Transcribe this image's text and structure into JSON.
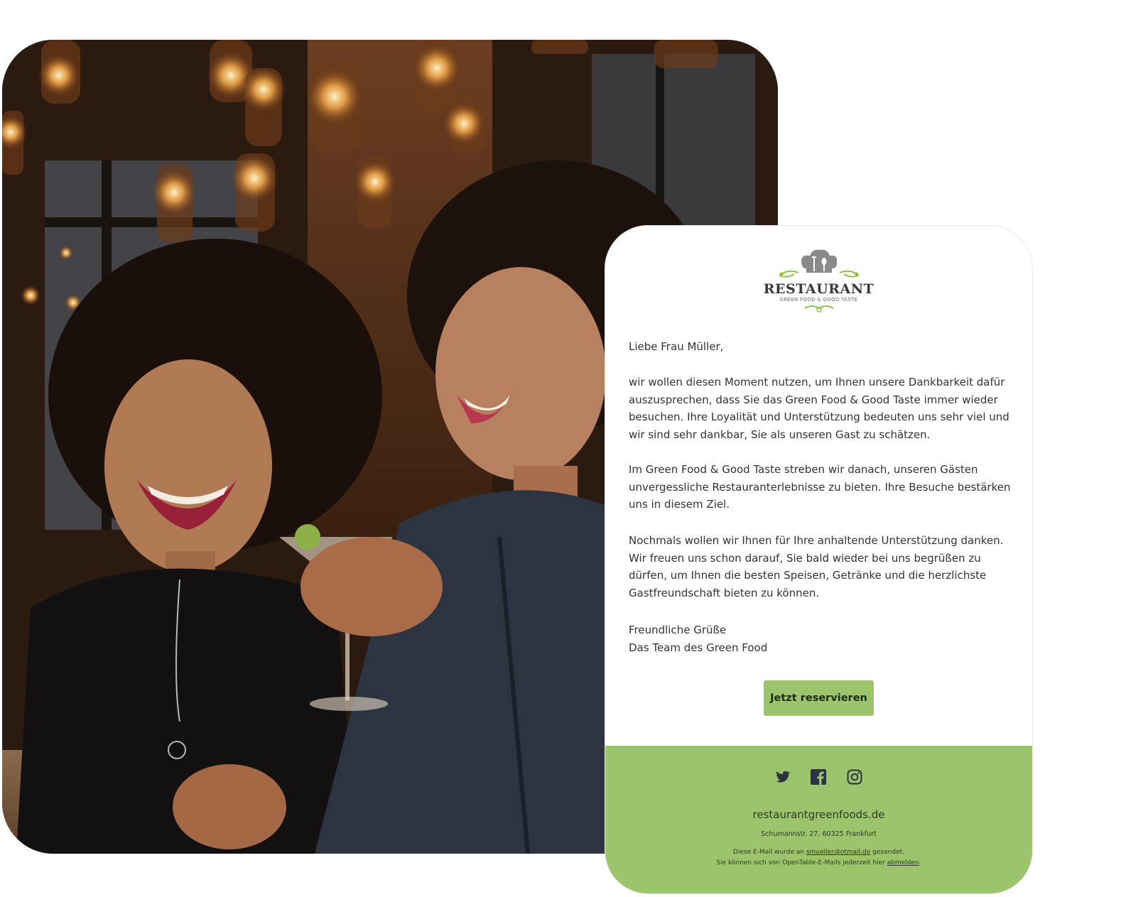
{
  "photo": {
    "description_icon": "photo-people-laughing"
  },
  "email": {
    "logo": {
      "title": "RESTAURANT",
      "subtitle": "GREEN FOOD & GOOD TASTE"
    },
    "salutation": "Liebe Frau Müller,",
    "paragraphs": [
      "wir wollen diesen Moment nutzen, um Ihnen unsere Dankbarkeit dafür auszusprechen, dass Sie das Green Food & Good Taste immer wieder besuchen. Ihre Loyalität und Unterstützung bedeuten uns sehr viel und wir sind sehr dankbar, Sie als unseren Gast zu schätzen.",
      "Im Green Food & Good Taste streben wir danach, unseren Gästen unvergessliche Restauranterlebnisse zu bieten. Ihre Besuche bestärken uns in diesem Ziel.",
      "Nochmals wollen wir Ihnen für Ihre anhaltende Unterstützung danken. Wir freuen uns schon darauf, Sie bald wieder bei uns begrüßen zu dürfen, um Ihnen die besten Speisen, Getränke und die herzlichste Gastfreundschaft bieten zu können."
    ],
    "closing": {
      "line1": "Freundliche Grüße",
      "line2": "Das Team des Green Food"
    },
    "cta_label": "Jetzt reservieren",
    "footer": {
      "social": [
        "twitter-icon",
        "facebook-icon",
        "instagram-icon"
      ],
      "domain": "restaurantgreenfoods.de",
      "address": "Schumannstr. 27, 60325 Frankfurt",
      "note1_prefix": "Diese E-Mail wurde an ",
      "note1_email": "smueller@otmail.de",
      "note1_suffix": " gesendet.",
      "note2_prefix": "Sie können sich von OpenTable-E-Mails jederzeit hier ",
      "note2_link": "abmelden",
      "note2_suffix": "."
    },
    "colors": {
      "accent_green": "#9cc46d",
      "text": "#333333",
      "footer_text": "#2e3a22"
    }
  }
}
